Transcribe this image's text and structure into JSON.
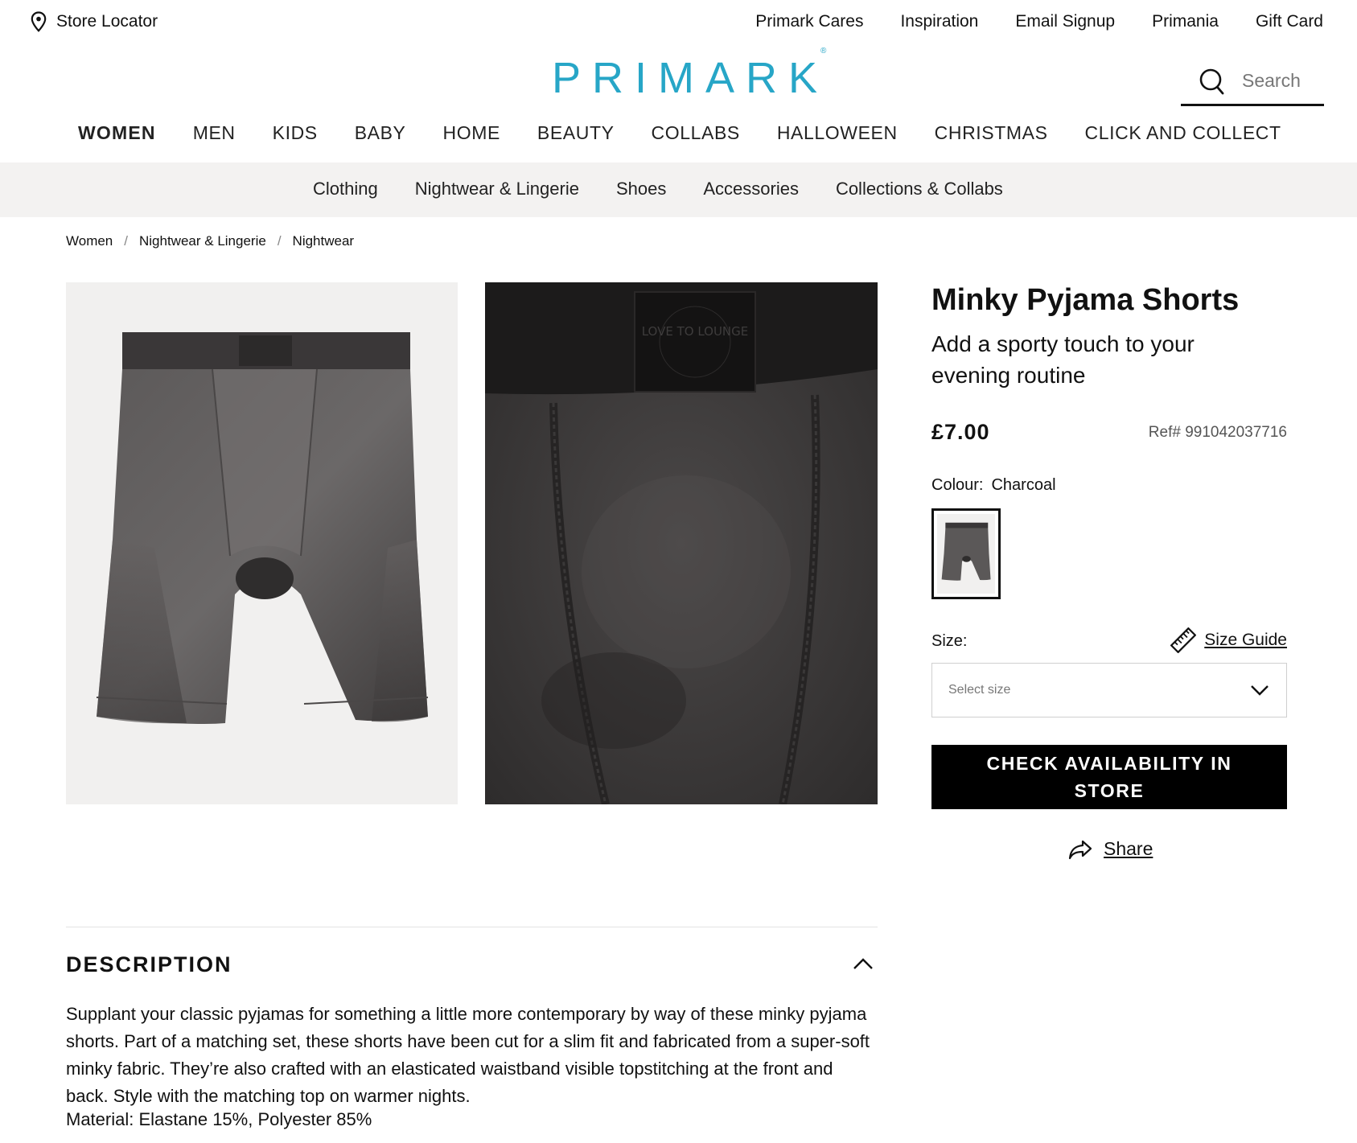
{
  "topbar": {
    "store_locator": "Store Locator",
    "links": [
      "Primark Cares",
      "Inspiration",
      "Email Signup",
      "Primania",
      "Gift Card"
    ]
  },
  "header": {
    "logo": "PRIMARK",
    "search_placeholder": "Search"
  },
  "main_nav": [
    "WOMEN",
    "MEN",
    "KIDS",
    "BABY",
    "HOME",
    "BEAUTY",
    "COLLABS",
    "HALLOWEEN",
    "CHRISTMAS",
    "CLICK AND COLLECT"
  ],
  "sub_nav": [
    "Clothing",
    "Nightwear & Lingerie",
    "Shoes",
    "Accessories",
    "Collections & Collabs"
  ],
  "breadcrumb": [
    "Women",
    "Nightwear & Lingerie",
    "Nightwear"
  ],
  "product": {
    "title": "Minky Pyjama Shorts",
    "subtitle": "Add a sporty touch to your evening routine",
    "price": "£7.00",
    "ref": "Ref# 991042037716",
    "colour_label": "Colour:",
    "colour_value": "Charcoal",
    "size_label": "Size:",
    "size_guide": "Size Guide",
    "size_placeholder": "Select size",
    "cta": "CHECK AVAILABILITY IN STORE",
    "share": "Share",
    "image_patch_text": "LOVE TO LOUNGE"
  },
  "description": {
    "heading": "DESCRIPTION",
    "body": "Supplant your classic pyjamas for something a little more contemporary by way of these minky pyjama shorts. Part of a matching set, these shorts have been cut for a slim fit and fabricated from a super-soft minky fabric. They’re also crafted with an elasticated waistband visible topstitching at the front and back. Style with the matching top on warmer nights.",
    "material": "Material: Elastane 15%, Polyester 85%"
  },
  "colors": {
    "brand": "#27a6c7",
    "subnav_bg": "#f3f2f1",
    "cta_bg": "#000000",
    "charcoal": "#4e4b4b"
  }
}
